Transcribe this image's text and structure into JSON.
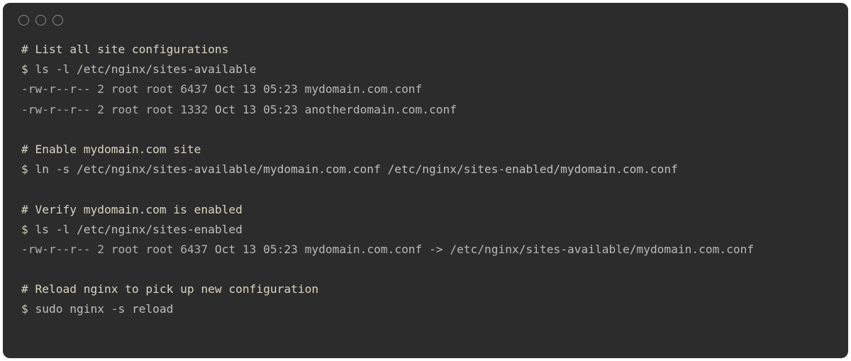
{
  "prompt": "$",
  "sections": {
    "listAvailable": {
      "comment": "# List all site configurations",
      "command": "ls -l /etc/nginx/sites-available",
      "rows": [
        {
          "perm": "-rw-r--r--",
          "links": "2",
          "owner": "root",
          "group": "root",
          "size": "6437",
          "date": "Oct 13 05:23",
          "name": "mydomain.com.conf"
        },
        {
          "perm": "-rw-r--r--",
          "links": "2",
          "owner": "root",
          "group": "root",
          "size": "1332",
          "date": "Oct 13 05:23",
          "name": "anotherdomain.com.conf"
        }
      ]
    },
    "enableSite": {
      "comment": "# Enable mydomain.com site",
      "command": "ln -s /etc/nginx/sites-available/mydomain.com.conf /etc/nginx/sites-enabled/mydomain.com.conf"
    },
    "verifyEnabled": {
      "comment": "# Verify mydomain.com is enabled",
      "command": "ls -l /etc/nginx/sites-enabled",
      "row": {
        "perm": "-rw-r--r--",
        "links": "2",
        "owner": "root",
        "group": "root",
        "size": "6437",
        "date": "Oct 13 05:23",
        "name": "mydomain.com.conf",
        "arrow": "->",
        "target": "/etc/nginx/sites-available/mydomain.com.conf"
      }
    },
    "reload": {
      "comment": "# Reload nginx to pick up new configuration",
      "command": "sudo nginx -s reload"
    }
  }
}
